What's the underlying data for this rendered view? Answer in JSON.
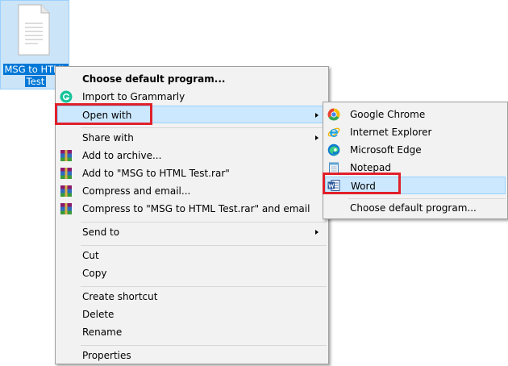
{
  "desktop": {
    "file_name_line1": "MSG to HTML",
    "file_name_line2": "Test",
    "file_icon": "document-file-icon"
  },
  "context_menu": {
    "items": [
      {
        "label": "Choose default program...",
        "bold": true,
        "icon": null
      },
      {
        "label": "Import to Grammarly",
        "icon": "grammarly-icon"
      },
      {
        "label": "Open with",
        "icon": null,
        "submenu": true
      },
      {
        "label": "Share with",
        "icon": null,
        "submenu": true
      },
      {
        "label": "Add to archive...",
        "icon": "winrar-icon"
      },
      {
        "label": "Add to \"MSG to HTML Test.rar\"",
        "icon": "winrar-icon"
      },
      {
        "label": "Compress and email...",
        "icon": "winrar-icon"
      },
      {
        "label": "Compress to \"MSG to HTML Test.rar\" and email",
        "icon": "winrar-icon"
      },
      {
        "label": "Send to",
        "icon": null,
        "submenu": true
      },
      {
        "label": "Cut",
        "icon": null
      },
      {
        "label": "Copy",
        "icon": null
      },
      {
        "label": "Create shortcut",
        "icon": null
      },
      {
        "label": "Delete",
        "icon": null
      },
      {
        "label": "Rename",
        "icon": null
      },
      {
        "label": "Properties",
        "icon": null
      }
    ]
  },
  "open_with_submenu": {
    "items": [
      {
        "label": "Google Chrome",
        "icon": "chrome-icon"
      },
      {
        "label": "Internet Explorer",
        "icon": "internet-explorer-icon"
      },
      {
        "label": "Microsoft Edge",
        "icon": "edge-icon"
      },
      {
        "label": "Notepad",
        "icon": "notepad-icon"
      },
      {
        "label": "Word",
        "icon": "word-icon",
        "highlighted": true
      },
      {
        "label": "Choose default program...",
        "icon": null
      }
    ]
  },
  "colors": {
    "highlight_red": "#e0202a",
    "menu_bg": "#f2f2f2",
    "hover_bg": "#cce8ff",
    "selection_blue": "#0078d7"
  }
}
